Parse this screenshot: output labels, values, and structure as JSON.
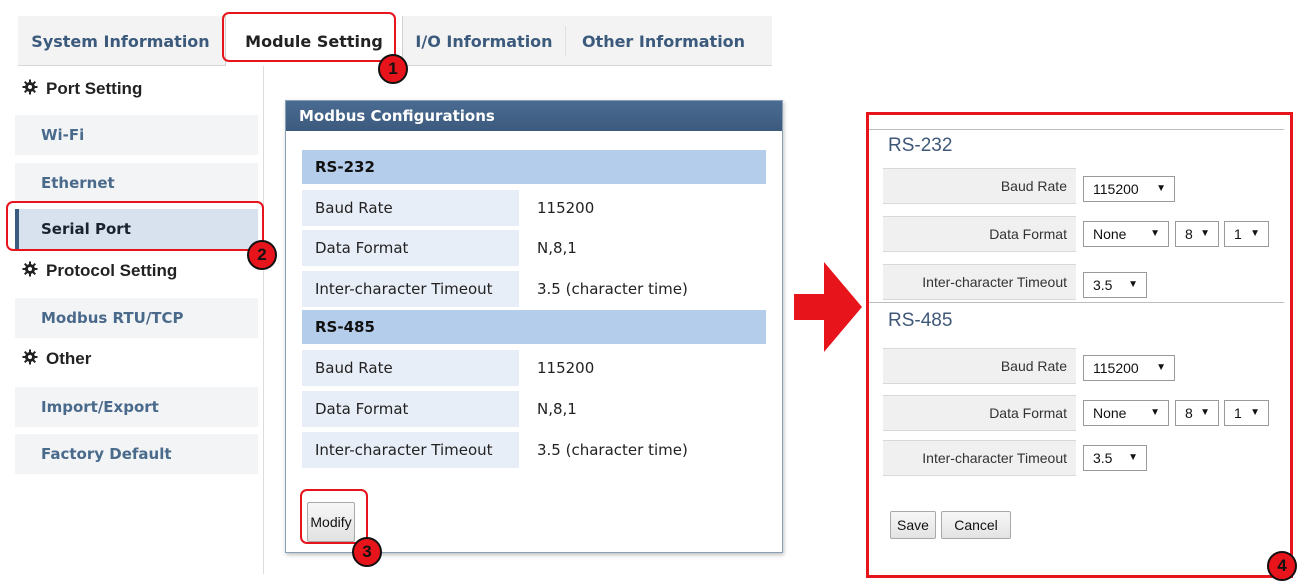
{
  "tabs": [
    {
      "label": "System Information"
    },
    {
      "label": "Module Setting"
    },
    {
      "label": "I/O Information"
    },
    {
      "label": "Other Information"
    }
  ],
  "sidebar": {
    "groups": [
      {
        "label": "Port Setting",
        "icon": "gear-icon"
      },
      {
        "label": "Protocol Setting",
        "icon": "gear-icon"
      },
      {
        "label": "Other",
        "icon": "gear-icon"
      }
    ],
    "items": [
      {
        "label": "Wi-Fi"
      },
      {
        "label": "Ethernet"
      },
      {
        "label": "Serial Port"
      },
      {
        "label": "Modbus RTU/TCP"
      },
      {
        "label": "Import/Export"
      },
      {
        "label": "Factory Default"
      }
    ],
    "active_item": "Serial Port"
  },
  "modbus": {
    "title": "Modbus Configurations",
    "sections": [
      {
        "name": "RS-232",
        "rows": [
          {
            "label": "Baud Rate",
            "value": "115200"
          },
          {
            "label": "Data Format",
            "value": "N,8,1"
          },
          {
            "label": "Inter-character Timeout",
            "value": "3.5 (character time)"
          }
        ]
      },
      {
        "name": "RS-485",
        "rows": [
          {
            "label": "Baud Rate",
            "value": "115200"
          },
          {
            "label": "Data Format",
            "value": "N,8,1"
          },
          {
            "label": "Inter-character Timeout",
            "value": "3.5 (character time)"
          }
        ]
      }
    ],
    "modify_label": "Modify"
  },
  "edit_form": {
    "sections": [
      {
        "name": "RS-232",
        "baud_label": "Baud Rate",
        "baud": "115200",
        "format_label": "Data Format",
        "parity": "None",
        "data_bits": "8",
        "stop_bits": "1",
        "timeout_label": "Inter-character Timeout",
        "timeout": "3.5"
      },
      {
        "name": "RS-485",
        "baud_label": "Baud Rate",
        "baud": "115200",
        "format_label": "Data Format",
        "parity": "None",
        "data_bits": "8",
        "stop_bits": "1",
        "timeout_label": "Inter-character Timeout",
        "timeout": "3.5"
      }
    ],
    "save_label": "Save",
    "cancel_label": "Cancel"
  },
  "annotations": {
    "step1": "1",
    "step2": "2",
    "step3": "3",
    "step4": "4",
    "color": "#e8141b"
  },
  "colors": {
    "panel_header": "#3c5a7d",
    "section_header": "#b4cdeb",
    "row_label_bg": "#e8eef7",
    "nav_text": "#4a6a8c"
  }
}
